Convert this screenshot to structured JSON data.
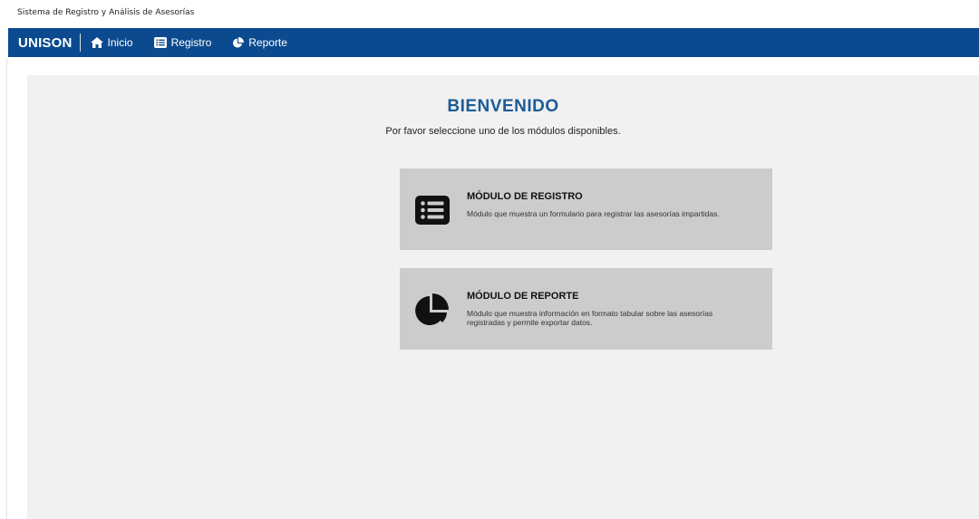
{
  "window": {
    "title": "Sistema de Registro y Análisis de Asesorías"
  },
  "navbar": {
    "brand": "UNISON",
    "items": [
      {
        "label": "Inicio",
        "icon": "home-icon"
      },
      {
        "label": "Registro",
        "icon": "list-icon"
      },
      {
        "label": "Reporte",
        "icon": "pie-chart-icon"
      }
    ]
  },
  "main": {
    "heading": "BIENVENIDO",
    "subheading": "Por favor seleccione uno de los módulos disponibles.",
    "cards": [
      {
        "title": "MÓDULO DE REGISTRO",
        "description": "Módulo que muestra un formulario para registrar las asesorías impartidas.",
        "icon": "list-icon"
      },
      {
        "title": "MÓDULO DE REPORTE",
        "description": "Módulo que muestra información en formato tabular sobre las asesorías registradas y permite exportar datos.",
        "icon": "pie-chart-icon"
      }
    ]
  },
  "colors": {
    "navbar": "#0b4a8f",
    "heading": "#1b5c97",
    "content_bg": "#f1f1f1",
    "card_bg": "#cccccc"
  }
}
